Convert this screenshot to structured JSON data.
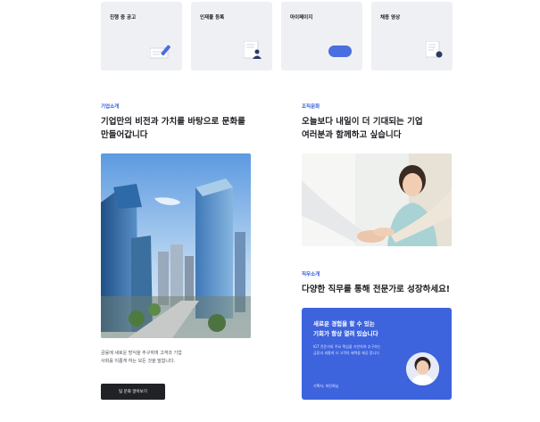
{
  "quick_links": [
    {
      "label": "진행 중 공고",
      "icon": "pencil-note-icon"
    },
    {
      "label": "인재풀 등록",
      "icon": "document-person-icon"
    },
    {
      "label": "마이페이지",
      "icon": "chat-bubble-icon"
    },
    {
      "label": "채용 영상",
      "icon": "document-play-icon"
    }
  ],
  "about": {
    "eyebrow": "기업소개",
    "heading_line1": "기업만의 비전과 가치를 바탕으로 문화를",
    "heading_line2": "만들어갑니다",
    "caption_line1": "금융에 새로운 방식을 추구하며 고객과 기업",
    "caption_line2": "사회를 이롭게 하는 모든 것을 말합니다.",
    "button_label": "팀 문화 알아보기"
  },
  "culture": {
    "eyebrow": "조직문화",
    "heading_line1": "오늘보다 내일이 더 기대되는 기업",
    "heading_line2": "여러분과 함께하고 싶습니다"
  },
  "jobs": {
    "eyebrow": "직무소개",
    "heading": "다양한 직무를 통해 전문가로 성장하세요!",
    "promo_title_line1": "새로운 경험을 할 수 있는",
    "promo_title_line2": "기회가 항상 열려 있습니다",
    "promo_desc_line1": "IGT 전문가와 주요 핵심을 기반하여 추구하는",
    "promo_desc_line2": "금융과 새롭게 더 고객의 혜택을 제공 합니다",
    "promo_caption": "기획자, 마진희님"
  },
  "colors": {
    "accent": "#2f5bd9",
    "promo_bg": "#3d63dd",
    "card_bg": "#eef0f3",
    "dark_button": "#202226"
  }
}
